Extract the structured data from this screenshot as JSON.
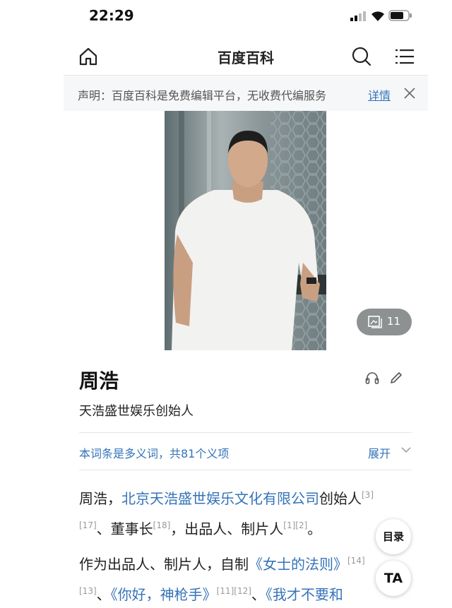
{
  "status_bar": {
    "time": "22:29"
  },
  "nav": {
    "title": "百度百科",
    "home_icon": "home-icon",
    "search_icon": "search-icon",
    "menu_icon": "menu-icon"
  },
  "notice": {
    "text": "声明：百度百科是免费编辑平台，无收费代编服务",
    "link": "详情"
  },
  "album": {
    "count": "11"
  },
  "entry": {
    "name": "周浩",
    "description": "天浩盛世娱乐创始人",
    "polysemy": "本词条是多义词，共81个义项",
    "expand": "展开"
  },
  "paragraph1": {
    "prefix": "周浩，",
    "company_link": "北京天浩盛世娱乐文化有限公司",
    "mid": "创始人",
    "ref_a": "[3]",
    "ref_b": "[17]",
    "text_b": "、董事长",
    "ref_c": "[18]",
    "text_c": "，出品人、制片人",
    "ref_d": "[1][2]",
    "text_d": "。"
  },
  "paragraph2": {
    "prefix": "作为出品人、制片人，自制",
    "work1": "《女士的法则》",
    "ref1": "[14]",
    "ref2": "[13]",
    "sep1": "、",
    "work2": "《你好，神枪手》",
    "ref3": "[11][12]",
    "sep2": "、",
    "work3": "《我才不要和"
  },
  "floating": {
    "toc": "目录",
    "ta": "TA"
  },
  "colors": {
    "link": "#3473b8",
    "notice_bg": "#f6f7f9"
  }
}
